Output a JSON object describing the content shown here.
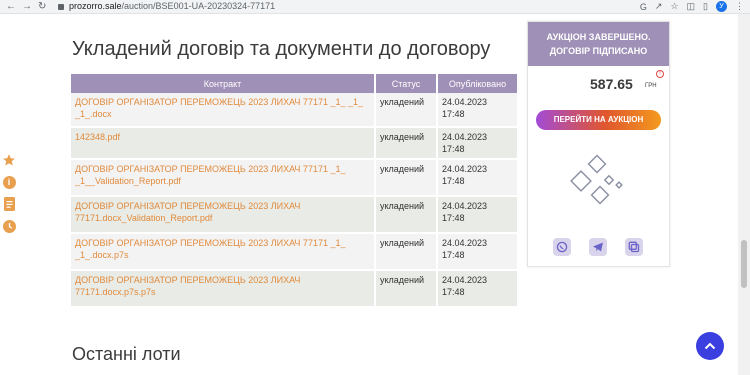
{
  "browser": {
    "url_host": "prozorro.sale",
    "url_path": "/auction/BSE001-UA-20230324-77171",
    "profile_initial": "У"
  },
  "page": {
    "heading": "Укладений договір та документи до договору",
    "latest_lots_heading": "Останні лоти"
  },
  "table": {
    "headers": [
      "Контракт",
      "Статус",
      "Опубліковано"
    ],
    "rows": [
      {
        "name_line1": "ДОГОВІР ОРГАНІЗАТОР ПЕРЕМОЖЕЦЬ 2023 ЛИХАЧ 77171 _1_ _1_",
        "name_line2": "_1_.docx",
        "status": "укладений",
        "date": "24.04.2023",
        "time": "17:48"
      },
      {
        "name_line1": "142348.pdf",
        "name_line2": "",
        "status": "укладений",
        "date": "24.04.2023",
        "time": "17:48"
      },
      {
        "name_line1": "ДОГОВІР ОРГАНІЗАТОР ПЕРЕМОЖЕЦЬ 2023 ЛИХАЧ 77171 _1_",
        "name_line2": "_1__Validation_Report.pdf",
        "status": "укладений",
        "date": "24.04.2023",
        "time": "17:48"
      },
      {
        "name_line1": "ДОГОВІР ОРГАНІЗАТОР ПЕРЕМОЖЕЦЬ 2023 ЛИХАЧ",
        "name_line2": "77171.docx_Validation_Report.pdf",
        "status": "укладений",
        "date": "24.04.2023",
        "time": "17:48"
      },
      {
        "name_line1": "ДОГОВІР ОРГАНІЗАТОР ПЕРЕМОЖЕЦЬ 2023 ЛИХАЧ 77171 _1_",
        "name_line2": "_1_.docx.p7s",
        "status": "укладений",
        "date": "24.04.2023",
        "time": "17:48"
      },
      {
        "name_line1": "ДОГОВІР ОРГАНІЗАТОР ПЕРЕМОЖЕЦЬ 2023 ЛИХАЧ",
        "name_line2": "77171.docx.p7s.p7s",
        "status": "укладений",
        "date": "24.04.2023",
        "time": "17:48"
      }
    ]
  },
  "card": {
    "banner_line1": "АУКЦІОН ЗАВЕРШЕНО.",
    "banner_line2": "ДОГОВІР ПІДПИСАНО",
    "price": "587.65",
    "currency": "ГРН",
    "button": "ПЕРЕЙТИ НА АУКЦІОН",
    "social": [
      "viber-icon",
      "telegram-icon",
      "copy-link-icon"
    ]
  },
  "colors": {
    "accent_purple": "#9f90b7",
    "link_orange": "#e08a3c",
    "side_orange": "#e8a04f",
    "to_top_blue": "#3b3fe0"
  }
}
